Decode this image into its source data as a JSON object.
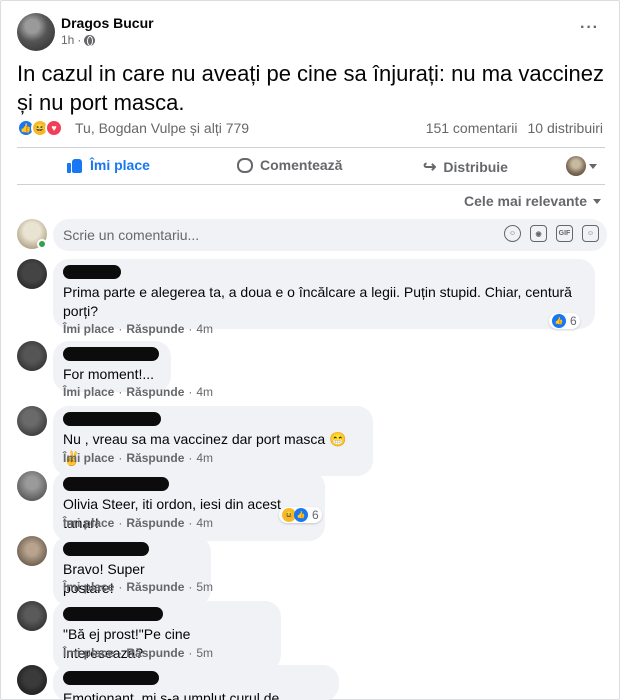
{
  "post": {
    "author": "Dragos Bucur",
    "time": "1h",
    "text": "In cazul in care nu aveați pe cine sa înjurați: nu ma vaccinez și nu port masca.",
    "reactions_names": "Tu, Bogdan Vulpe și alți 779",
    "comments_count": "151 comentarii",
    "shares_count": "10 distribuiri"
  },
  "actions": {
    "like_label": "Îmi place",
    "comment_label": "Comentează",
    "share_label": "Distribuie"
  },
  "sort": {
    "label": "Cele mai relevante"
  },
  "composer": {
    "placeholder": "Scrie un comentariu..."
  },
  "comments": [
    {
      "text": "Prima parte e alegerea ta, a doua e o încălcare a legii. Puțin stupid. Chiar, centură porți?",
      "time": "4m",
      "reaction_count": "6"
    },
    {
      "text": "For moment!...",
      "time": "4m"
    },
    {
      "text": "Nu , vreau sa ma vaccinez dar port masca",
      "emoji": "😁 ✌",
      "time": "4m"
    },
    {
      "text": "Olivia Steer, iti ordon, iesi din acest tanar!",
      "time": "4m",
      "reaction_count": "6"
    },
    {
      "text": "Bravo! Super postare!",
      "time": "5m"
    },
    {
      "text": "\"Bă ej prost!\"Pe cine intereseaza?",
      "time": "5m"
    },
    {
      "text": "Emoționant, mi s-a umplut curul de lacrimi!"
    }
  ],
  "comment_actions": {
    "like": "Îmi place",
    "reply": "Răspunde",
    "separator": "·"
  },
  "icons": {
    "more": "more-horizontal-icon",
    "globe": "globe-icon",
    "like": "like-thumb-icon",
    "comment": "comment-bubble-icon",
    "share": "share-arrow-icon",
    "emoji": "smiley-icon",
    "camera": "camera-icon",
    "gif": "gif-icon",
    "sticker": "sticker-icon"
  },
  "colors": {
    "accent": "#1877f2",
    "muted": "#65676b",
    "bubble": "#f0f2f5"
  }
}
